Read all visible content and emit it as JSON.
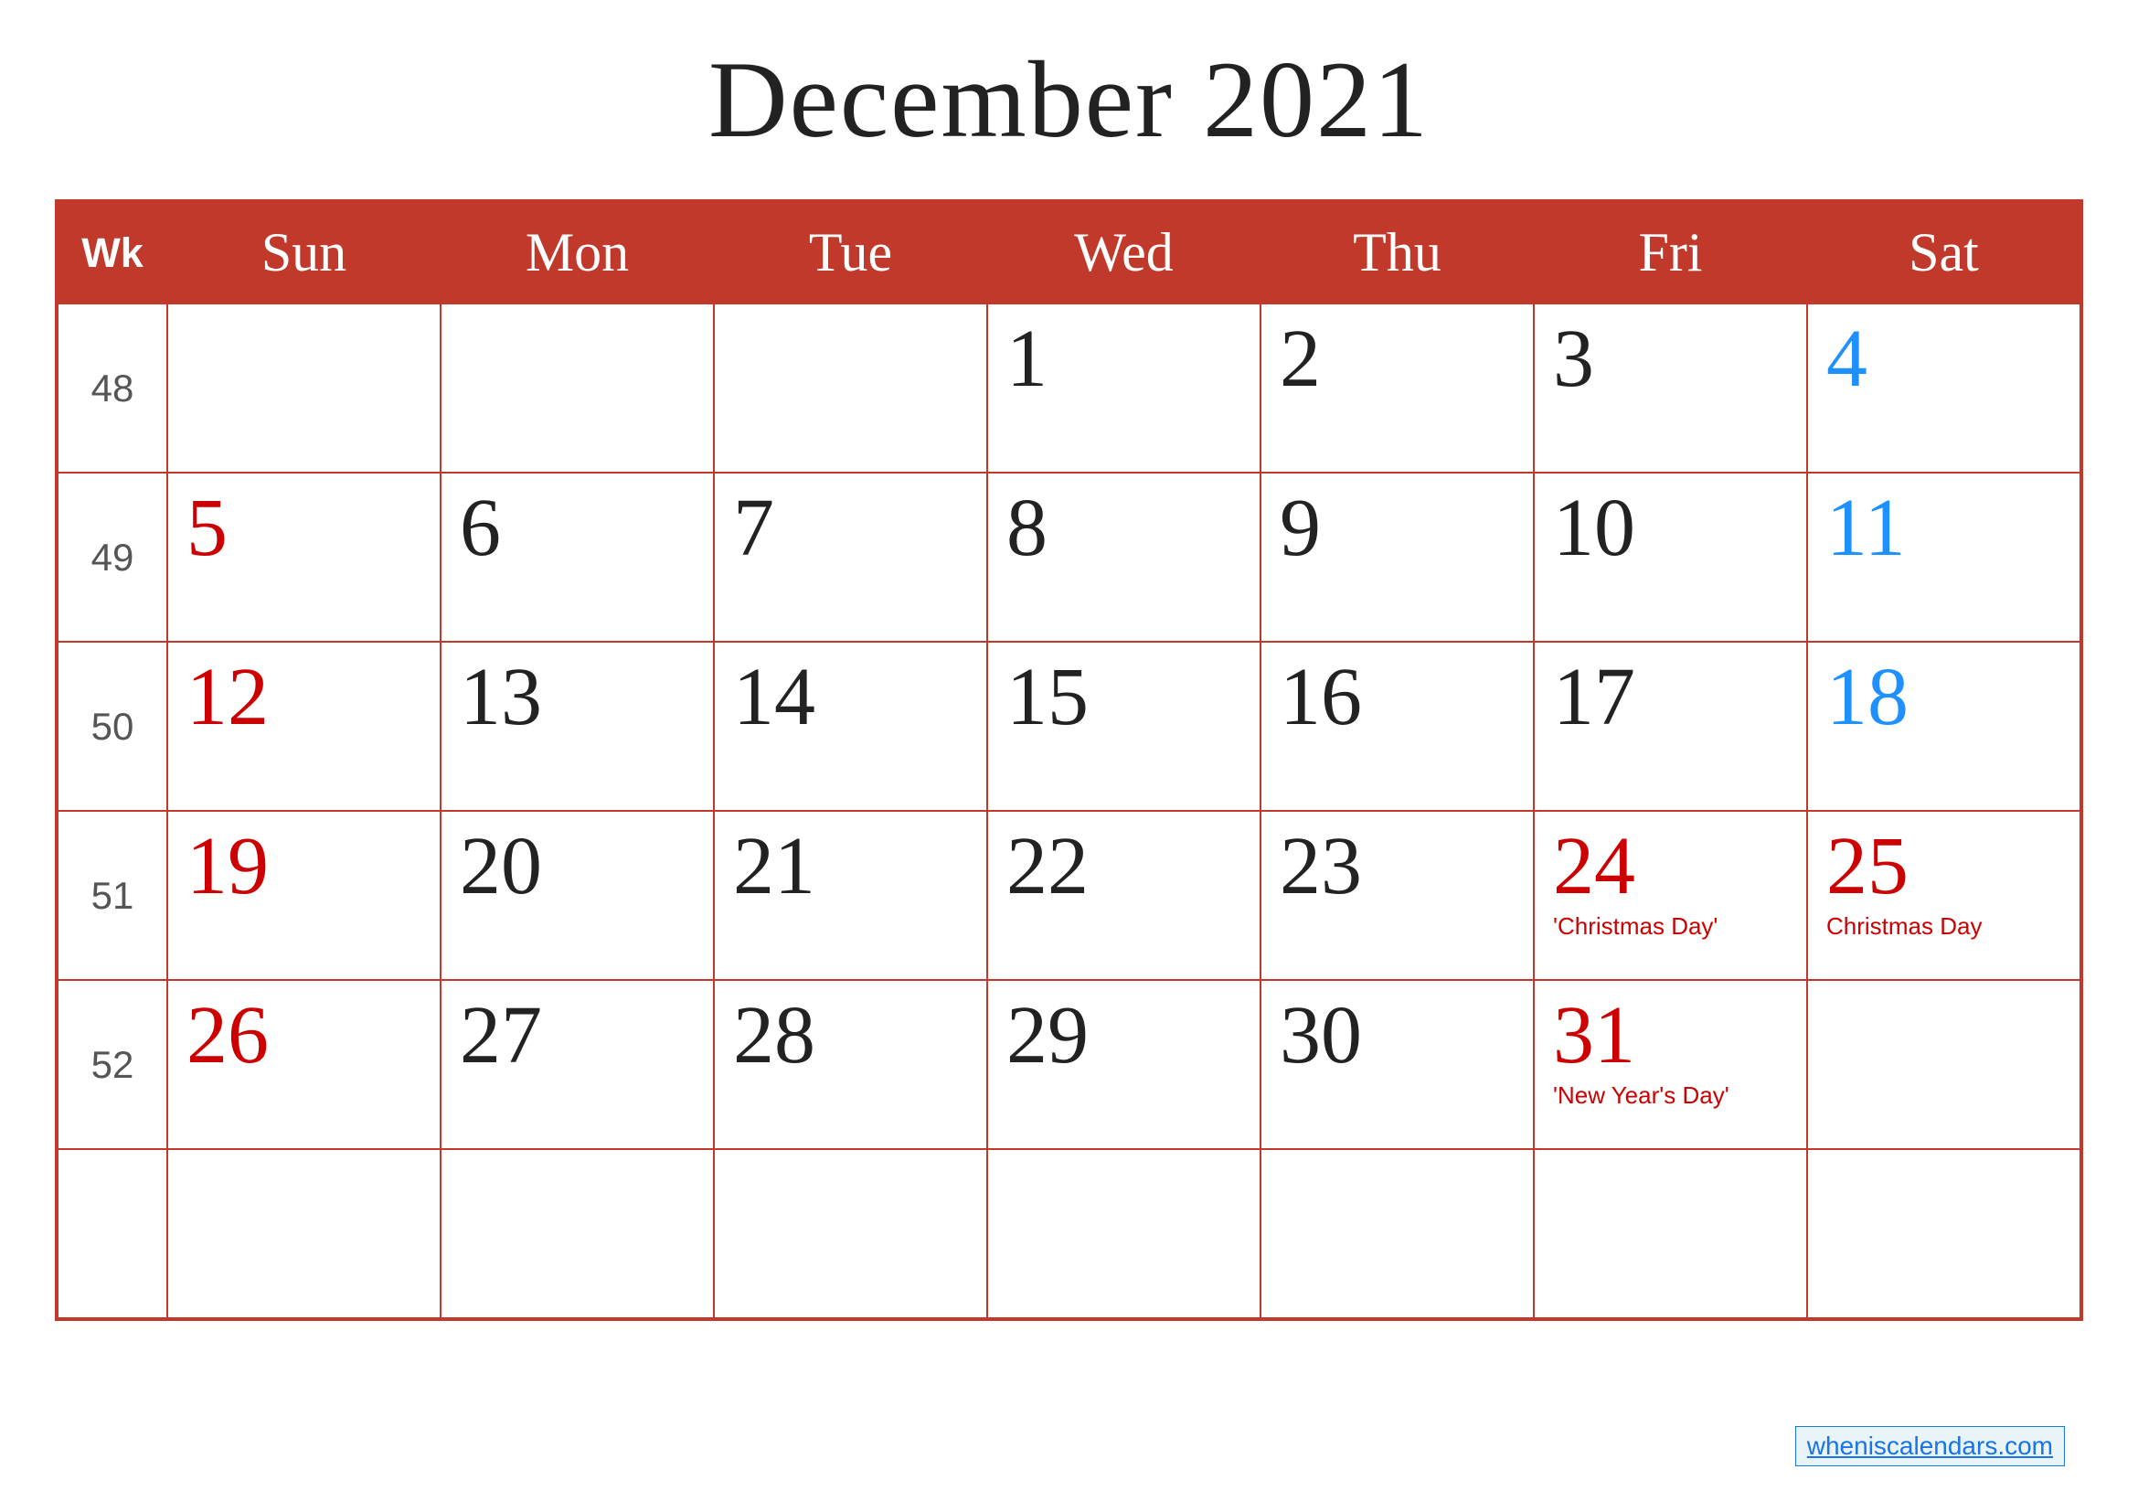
{
  "header": {
    "title": "December 2021"
  },
  "columns": {
    "wk": "Wk",
    "sun": "Sun",
    "mon": "Mon",
    "tue": "Tue",
    "wed": "Wed",
    "thu": "Thu",
    "fri": "Fri",
    "sat": "Sat"
  },
  "weeks": [
    {
      "wk": "48",
      "days": [
        {
          "num": "",
          "color": "black"
        },
        {
          "num": "",
          "color": "black"
        },
        {
          "num": "",
          "color": "black"
        },
        {
          "num": "1",
          "color": "black"
        },
        {
          "num": "2",
          "color": "black"
        },
        {
          "num": "3",
          "color": "black"
        },
        {
          "num": "4",
          "color": "blue"
        }
      ]
    },
    {
      "wk": "49",
      "days": [
        {
          "num": "5",
          "color": "red"
        },
        {
          "num": "6",
          "color": "black"
        },
        {
          "num": "7",
          "color": "black"
        },
        {
          "num": "8",
          "color": "black"
        },
        {
          "num": "9",
          "color": "black"
        },
        {
          "num": "10",
          "color": "black"
        },
        {
          "num": "11",
          "color": "blue"
        }
      ]
    },
    {
      "wk": "50",
      "days": [
        {
          "num": "12",
          "color": "red"
        },
        {
          "num": "13",
          "color": "black"
        },
        {
          "num": "14",
          "color": "black"
        },
        {
          "num": "15",
          "color": "black"
        },
        {
          "num": "16",
          "color": "black"
        },
        {
          "num": "17",
          "color": "black"
        },
        {
          "num": "18",
          "color": "blue"
        }
      ]
    },
    {
      "wk": "51",
      "days": [
        {
          "num": "19",
          "color": "red"
        },
        {
          "num": "20",
          "color": "black"
        },
        {
          "num": "21",
          "color": "black"
        },
        {
          "num": "22",
          "color": "black"
        },
        {
          "num": "23",
          "color": "black"
        },
        {
          "num": "24",
          "color": "red",
          "holiday": "'Christmas Day'"
        },
        {
          "num": "25",
          "color": "red",
          "holiday": "Christmas Day"
        }
      ]
    },
    {
      "wk": "52",
      "days": [
        {
          "num": "26",
          "color": "red"
        },
        {
          "num": "27",
          "color": "black"
        },
        {
          "num": "28",
          "color": "black"
        },
        {
          "num": "29",
          "color": "black"
        },
        {
          "num": "30",
          "color": "black"
        },
        {
          "num": "31",
          "color": "red",
          "holiday": "'New Year's Day'"
        },
        {
          "num": "",
          "color": "black"
        }
      ]
    },
    {
      "wk": "",
      "days": [
        {
          "num": "",
          "color": "black"
        },
        {
          "num": "",
          "color": "black"
        },
        {
          "num": "",
          "color": "black"
        },
        {
          "num": "",
          "color": "black"
        },
        {
          "num": "",
          "color": "black"
        },
        {
          "num": "",
          "color": "black"
        },
        {
          "num": "",
          "color": "black"
        }
      ]
    }
  ],
  "watermark": {
    "text": "wheniscalendars.com",
    "url": "#"
  }
}
